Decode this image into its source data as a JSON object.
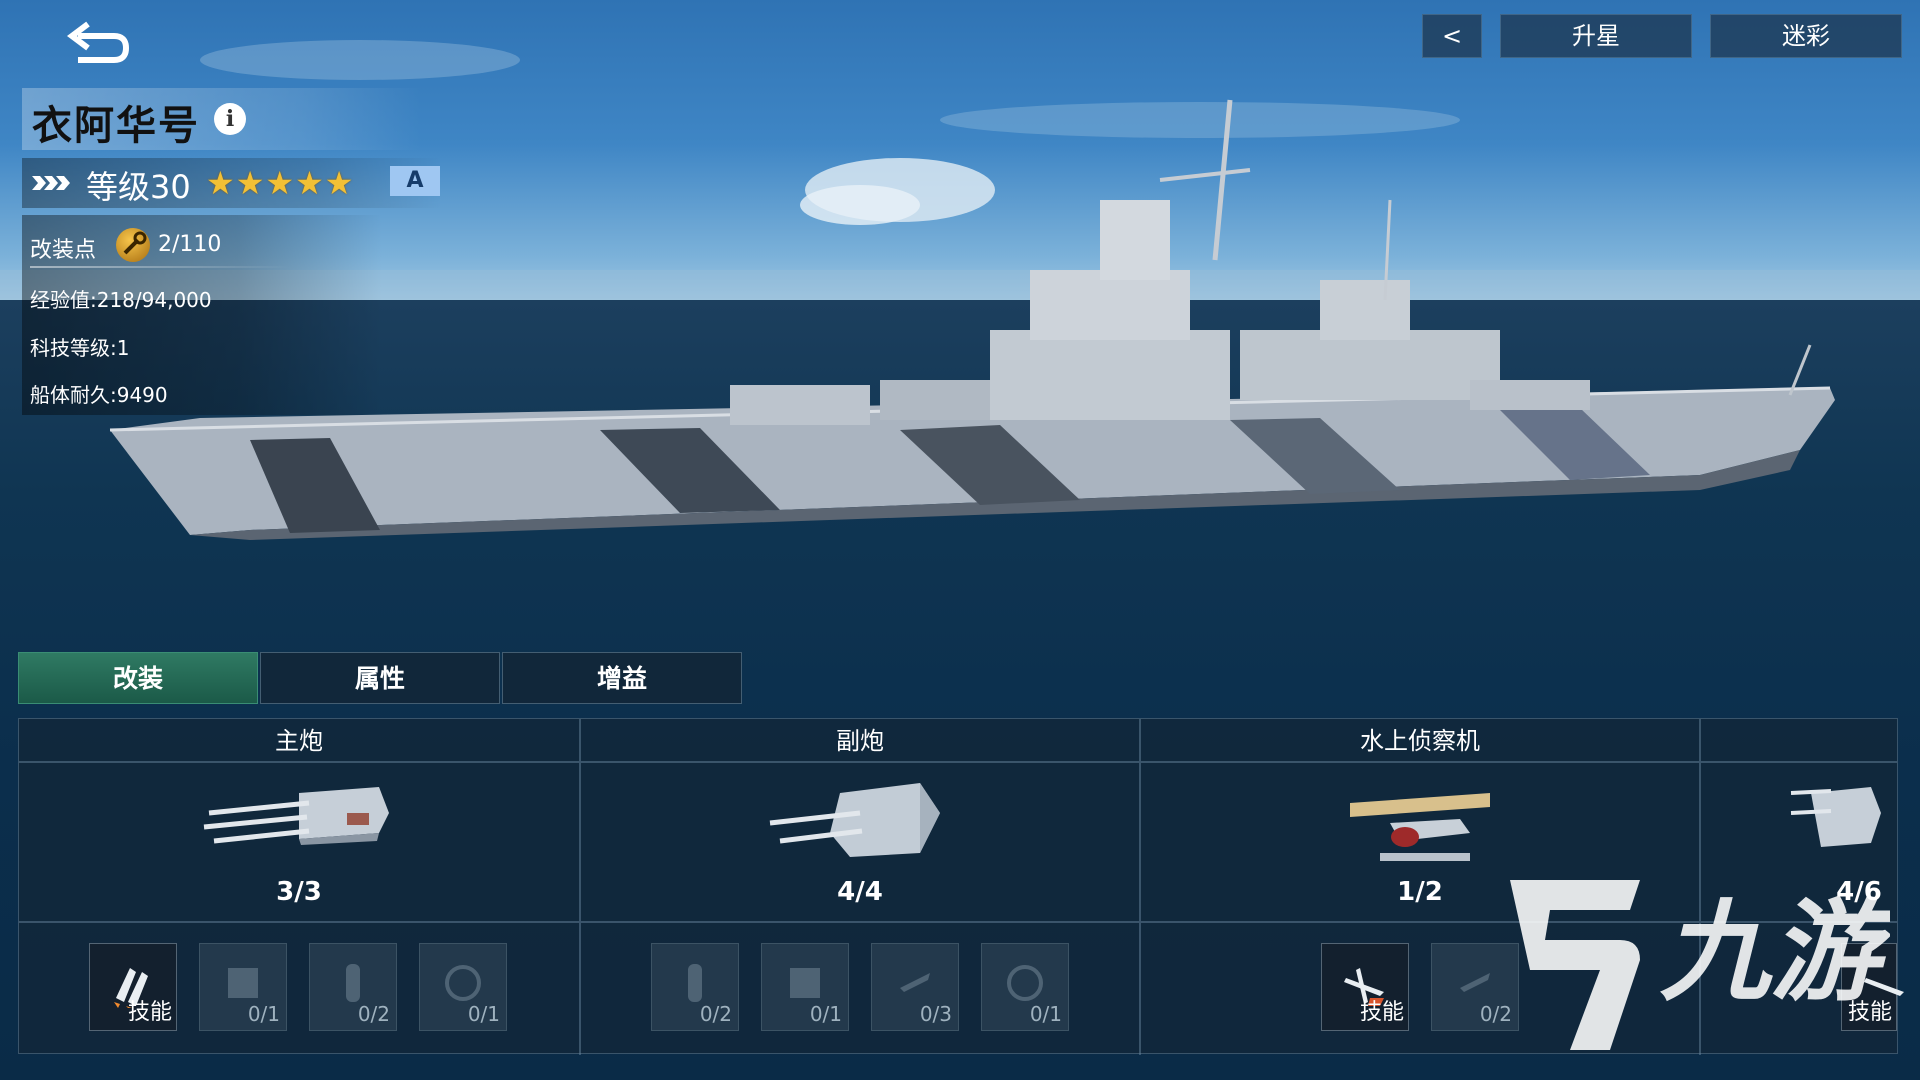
{
  "header": {
    "ship_name": "衣阿华号",
    "level_label": "等级30",
    "stars": "★★★★★",
    "grade": "A"
  },
  "stats": {
    "mod_points_label": "改装点",
    "mod_points_value": "2/110",
    "exp": "经验值:218/94,000",
    "tech_level": "科技等级:1",
    "hull_durability": "船体耐久:9490"
  },
  "top_nav": {
    "prev_icon": "<",
    "upstar_label": "升星",
    "camo_label": "迷彩"
  },
  "tabs": [
    {
      "label": "改装",
      "active": true
    },
    {
      "label": "属性",
      "active": false
    },
    {
      "label": "增益",
      "active": false
    }
  ],
  "equipment": [
    {
      "title": "主炮",
      "count": "3/3",
      "icon": "main-gun-turret",
      "slots": [
        {
          "label": "技能",
          "skill": true
        },
        {
          "label": "0/1"
        },
        {
          "label": "0/2"
        },
        {
          "label": "0/1"
        }
      ]
    },
    {
      "title": "副炮",
      "count": "4/4",
      "icon": "secondary-gun-turret",
      "slots": [
        {
          "label": "0/2"
        },
        {
          "label": "0/1"
        },
        {
          "label": "0/3"
        },
        {
          "label": "0/1"
        }
      ]
    },
    {
      "title": "水上侦察机",
      "count": "1/2",
      "icon": "seaplane",
      "slots": [
        {
          "label": "技能",
          "skill": true
        },
        {
          "label": "0/2"
        }
      ]
    },
    {
      "title": "",
      "count": "4/6",
      "icon": "aa-gun",
      "slots": [
        {
          "label": "技能",
          "skill": true
        }
      ]
    }
  ],
  "watermark": {
    "brand": "九游"
  },
  "colors": {
    "star": "#f2c035",
    "active_tab": "#2f7a63",
    "grade_badge": "#9fc7f2"
  }
}
